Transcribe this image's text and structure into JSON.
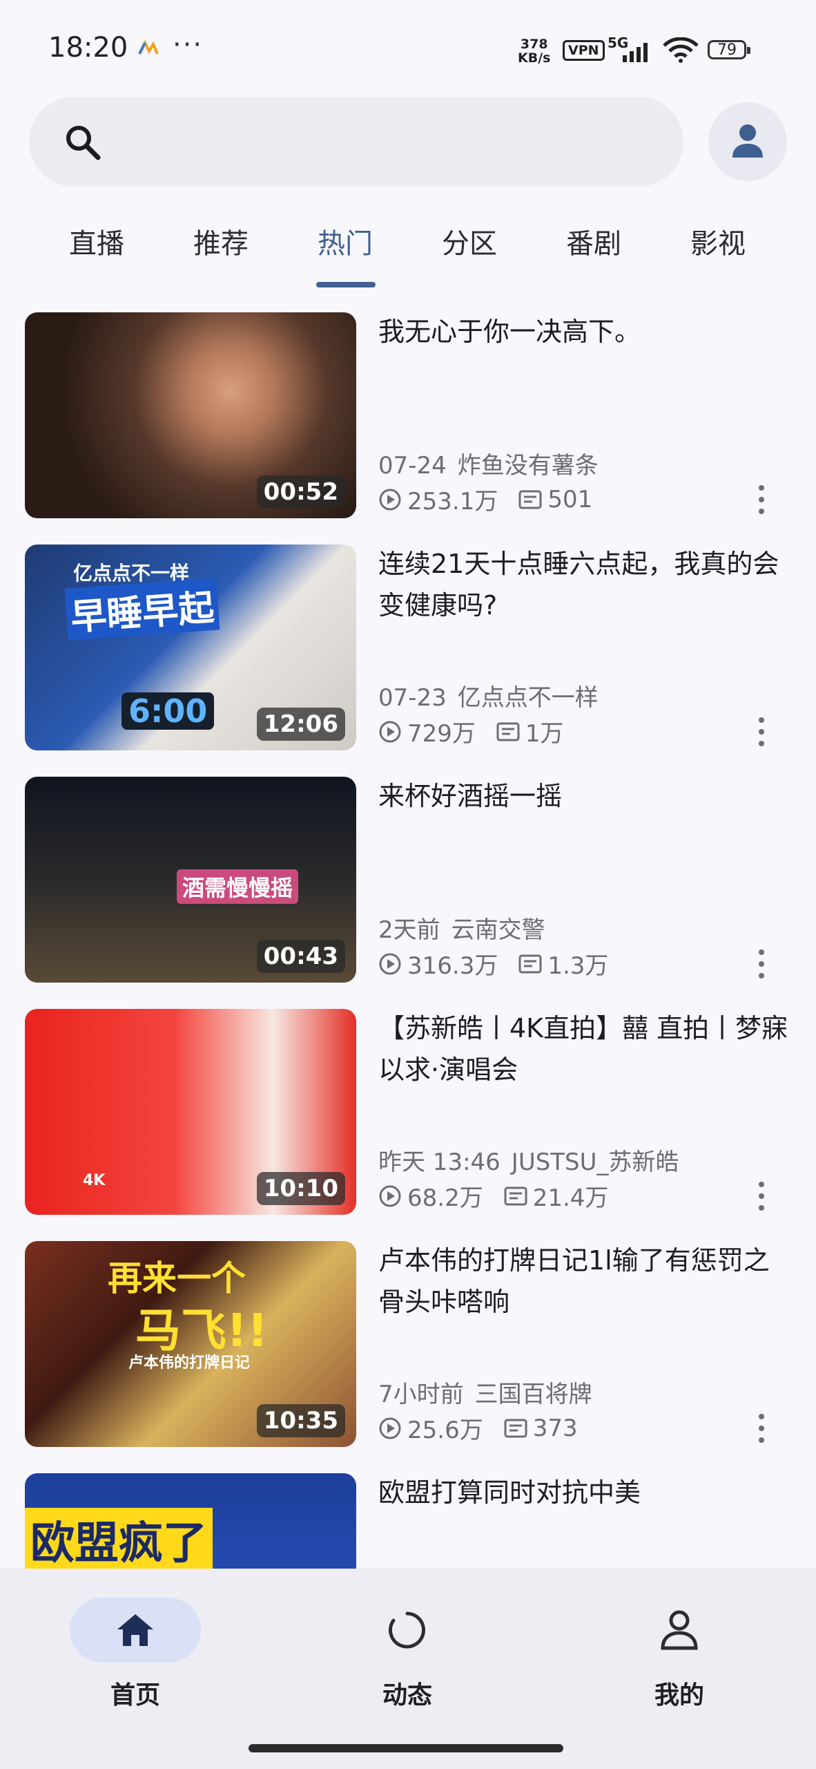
{
  "status_bar": {
    "time": "18:20",
    "more": "···",
    "speed_value": "378",
    "speed_unit": "KB/s",
    "vpn": "VPN",
    "network": "5G",
    "battery": "79"
  },
  "search": {
    "icon": "search-icon"
  },
  "tabs": [
    {
      "label": "直播"
    },
    {
      "label": "推荐"
    },
    {
      "label": "热门",
      "active": true
    },
    {
      "label": "分区"
    },
    {
      "label": "番剧"
    },
    {
      "label": "影视"
    }
  ],
  "videos": [
    {
      "title": "我无心于你一决高下。",
      "date": "07-24",
      "author": "炸鱼没有薯条",
      "views": "253.1万",
      "danmaku": "501",
      "duration": "00:52"
    },
    {
      "title": "连续21天十点睡六点起，我真的会变健康吗?",
      "date": "07-23",
      "author": "亿点点不一样",
      "views": "729万",
      "danmaku": "1万",
      "duration": "12:06",
      "thumb_text_1": "亿点点不一样",
      "thumb_text_2": "早睡早起",
      "thumb_text_3": "6:00"
    },
    {
      "title": "来杯好酒摇一摇",
      "date": "2天前",
      "author": "云南交警",
      "views": "316.3万",
      "danmaku": "1.3万",
      "duration": "00:43",
      "thumb_text_1": "酒需慢慢摇"
    },
    {
      "title": "【苏新皓丨4K直拍】囍 直拍丨梦寐以求·演唱会",
      "date": "昨天 13:46",
      "author": "JUSTSU_苏新皓",
      "views": "68.2万",
      "danmaku": "21.4万",
      "duration": "10:10",
      "thumb_text_1": "4K"
    },
    {
      "title": "卢本伟的打牌日记1l输了有惩罚之骨头咔嗒响",
      "date": "7小时前",
      "author": "三国百将牌",
      "views": "25.6万",
      "danmaku": "373",
      "duration": "10:35",
      "thumb_text_1": "再来一个",
      "thumb_text_2": "马飞!!",
      "thumb_text_3": "卢本伟的打牌日记"
    },
    {
      "title": "欧盟打算同时对抗中美",
      "thumb_text_1": "欧盟疯了"
    }
  ],
  "bottom_nav": [
    {
      "label": "首页",
      "icon": "home-icon",
      "active": true
    },
    {
      "label": "动态",
      "icon": "activity-icon"
    },
    {
      "label": "我的",
      "icon": "profile-icon"
    }
  ]
}
